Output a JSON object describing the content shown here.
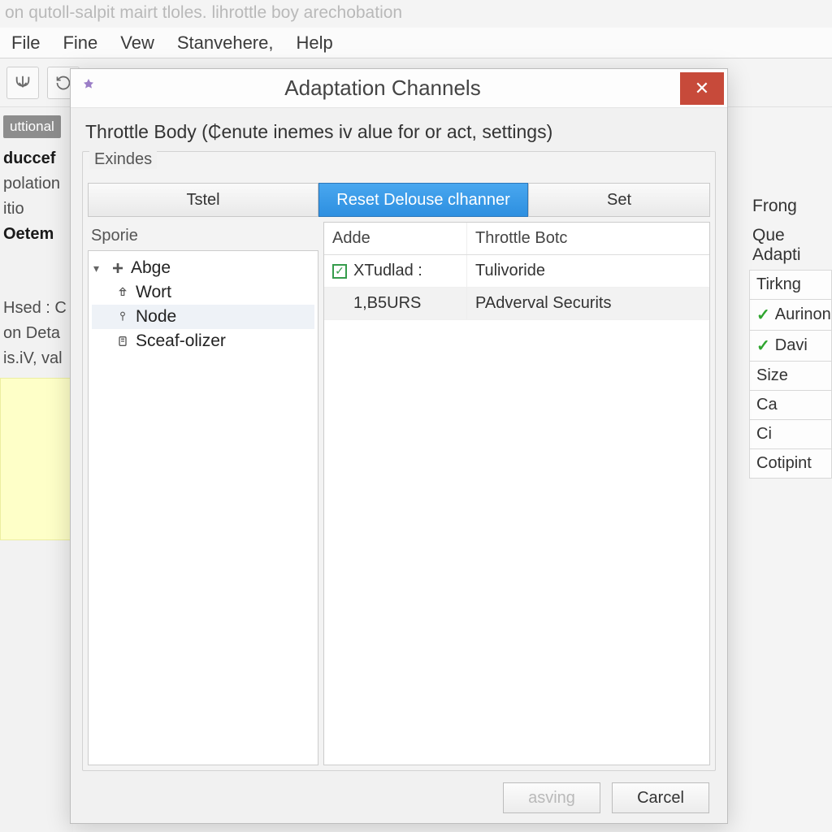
{
  "app": {
    "bg_title": "on qutoll-salpit mairt tloles. lihrottle boy arechobation"
  },
  "menu": {
    "items": [
      "File",
      "Fine",
      "Vew",
      "Stanvehere,",
      "Help"
    ]
  },
  "left": {
    "chip": "uttional",
    "l1": "duccef",
    "l2": "polation",
    "l3": "itio",
    "l4": "Oetem",
    "l5": "Hsed : C",
    "l6": "on Deta",
    "l7": "is.iV, val"
  },
  "right": {
    "h1": "Frong",
    "h2": "Que Adapti",
    "cells": [
      "Tirkng",
      "Aurinon",
      "Davi",
      "Size",
      "Ca",
      "Ci",
      "Cotipint"
    ]
  },
  "dialog": {
    "title": "Adaptation Channels",
    "subtitle": "Throttle Body (₵enute inemes iv alue for or act, settings)",
    "group_label": "Exindes",
    "tabs": {
      "t1": "Tstel",
      "t2": "Reset Delouse clhanner",
      "t3": "Set"
    },
    "tree_label": "Sporie",
    "tree": {
      "root": "Abge",
      "children": [
        "Wort",
        "Node",
        "Sceaf-olizer"
      ]
    },
    "grid": {
      "colA": "Adde",
      "colB": "Throttle Botc",
      "rows": [
        {
          "checked": true,
          "a": "XTudlad :",
          "b": "Tulivoride"
        },
        {
          "checked": false,
          "a": "1,B5URS",
          "b": "PAdverval Securits"
        }
      ]
    },
    "buttons": {
      "ok": "asving",
      "cancel": "Carcel"
    }
  }
}
